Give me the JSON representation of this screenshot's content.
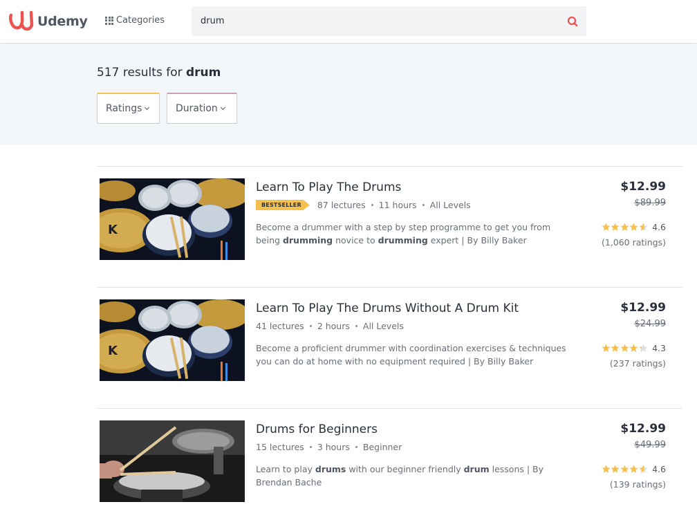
{
  "header": {
    "logo_text": "Udemy",
    "categories_label": "Categories",
    "search_value": "drum",
    "accent_color": "#ec5252"
  },
  "results": {
    "count_prefix": "517 results for ",
    "query": "drum",
    "filters": [
      "Ratings",
      "Duration"
    ]
  },
  "courses": [
    {
      "title": "Learn To Play The Drums",
      "badge": "BESTSELLER",
      "lectures": "87 lectures",
      "hours": "11 hours",
      "level": "All Levels",
      "desc_parts": [
        "Become a drummer with a step by step programme to get you from being ",
        "drumming",
        " novice to ",
        "drumming",
        " expert | By Billy Baker"
      ],
      "price": "$12.99",
      "old_price": "$89.99",
      "rating": "4.6",
      "rating_value": 4.6,
      "ratings_count": "(1,060 ratings)"
    },
    {
      "title": "Learn To Play The Drums Without A Drum Kit",
      "badge": "",
      "lectures": "41 lectures",
      "hours": "2 hours",
      "level": "All Levels",
      "desc_parts": [
        "Become a proficient drummer with coordination exercises & techniques you can do at home with no equipment required | By Billy Baker"
      ],
      "price": "$12.99",
      "old_price": "$24.99",
      "rating": "4.3",
      "rating_value": 4.3,
      "ratings_count": "(237 ratings)"
    },
    {
      "title": "Drums for Beginners",
      "badge": "",
      "lectures": "15 lectures",
      "hours": "3 hours",
      "level": "Beginner",
      "desc_parts": [
        "Learn to play ",
        "drums",
        " with our beginner friendly ",
        "drum",
        " lessons | By Brendan Bache"
      ],
      "price": "$12.99",
      "old_price": "$49.99",
      "rating": "4.6",
      "rating_value": 4.6,
      "ratings_count": "(139 ratings)"
    }
  ],
  "colors": {
    "star": "#f4c150",
    "star_empty": "#dedfe0",
    "badge": "#f4c150"
  }
}
